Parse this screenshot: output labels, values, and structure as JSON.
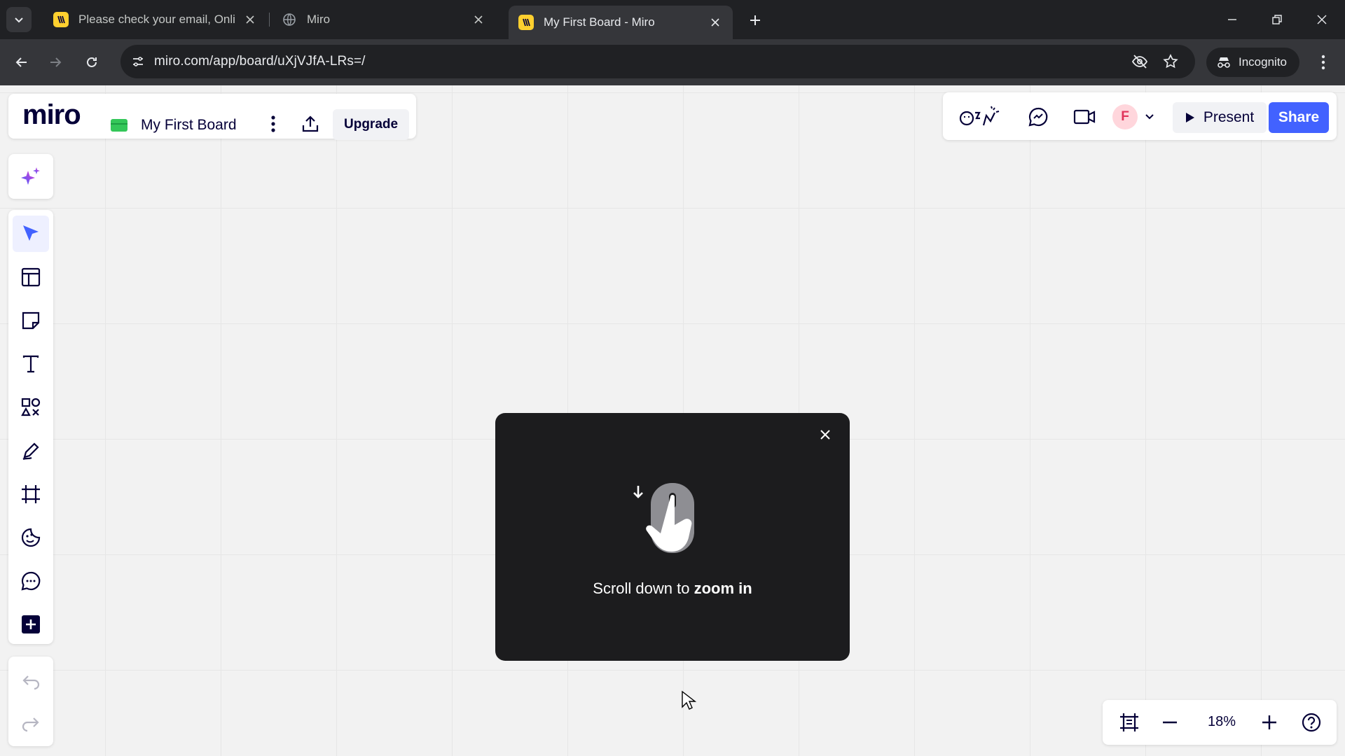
{
  "browser": {
    "tabs": [
      {
        "title": "Please check your email, Online",
        "active": false
      },
      {
        "title": "Miro",
        "active": false
      },
      {
        "title": "My First Board - Miro",
        "active": true
      }
    ],
    "url": "miro.com/app/board/uXjVJfA-LRs=/",
    "incognito_label": "Incognito"
  },
  "board": {
    "logo": "miro",
    "name": "My First Board",
    "upgrade_label": "Upgrade",
    "avatar_initial": "F",
    "present_label": "Present",
    "share_label": "Share",
    "zoom": "18%"
  },
  "hint": {
    "text_plain": "Scroll down to ",
    "text_bold": "zoom in"
  },
  "colors": {
    "accent": "#4262ff",
    "board_bg": "#f2f2f2",
    "hint_bg": "#1c1c1e"
  }
}
